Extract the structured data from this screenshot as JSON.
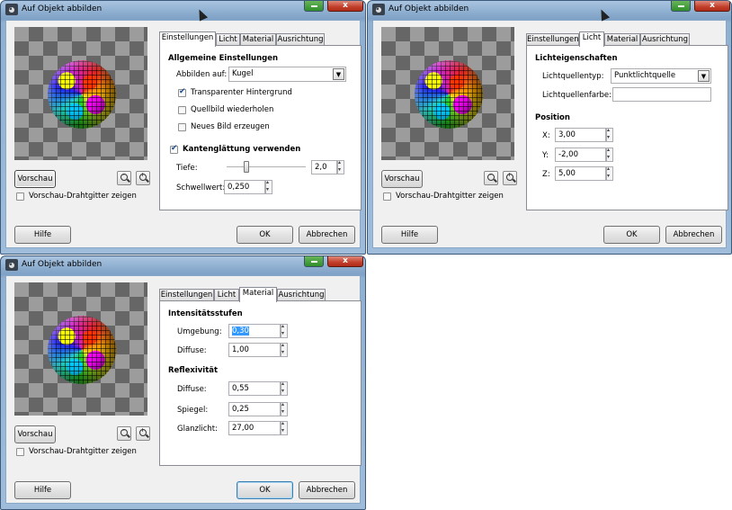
{
  "windows": [
    {
      "title": "Auf Objekt abbilden",
      "tabs": [
        "Einstellungen",
        "Licht",
        "Material",
        "Ausrichtung"
      ],
      "selected_tab": 0,
      "preview_button": "Vorschau",
      "wireframe_label": "Vorschau-Drahtgitter zeigen",
      "help_button": "Hilfe",
      "ok_button": "OK",
      "cancel_button": "Abbrechen",
      "close_glyph": "x",
      "panel": {
        "general_heading": "Allgemeine Einstellungen",
        "map_to_label": "Abbilden auf:",
        "map_to_value": "Kugel",
        "transparent_bg": "Transparenter Hintergrund",
        "tile_source": "Quellbild wiederholen",
        "new_image": "Neues Bild erzeugen",
        "antialias": "Kantenglättung verwenden",
        "depth_label": "Tiefe:",
        "depth_value": "2,0",
        "threshold_label": "Schwellwert:",
        "threshold_value": "0,250"
      }
    },
    {
      "title": "Auf Objekt abbilden",
      "tabs": [
        "Einstellungen",
        "Licht",
        "Material",
        "Ausrichtung"
      ],
      "selected_tab": 1,
      "preview_button": "Vorschau",
      "wireframe_label": "Vorschau-Drahtgitter zeigen",
      "help_button": "Hilfe",
      "ok_button": "OK",
      "cancel_button": "Abbrechen",
      "close_glyph": "x",
      "panel": {
        "light_heading": "Lichteigenschaften",
        "light_type_label": "Lichtquellentyp:",
        "light_type_value": "Punktlichtquelle",
        "light_color_label": "Lichtquellenfarbe:",
        "position_heading": "Position",
        "x_label": "X:",
        "x_value": "3,00",
        "y_label": "Y:",
        "y_value": "-2,00",
        "z_label": "Z:",
        "z_value": "5,00"
      }
    },
    {
      "title": "Auf Objekt abbilden",
      "tabs": [
        "Einstellungen",
        "Licht",
        "Material",
        "Ausrichtung"
      ],
      "selected_tab": 2,
      "preview_button": "Vorschau",
      "wireframe_label": "Vorschau-Drahtgitter zeigen",
      "help_button": "Hilfe",
      "ok_button": "OK",
      "cancel_button": "Abbrechen",
      "close_glyph": "x",
      "panel": {
        "intensity_heading": "Intensitätsstufen",
        "ambient_label": "Umgebung:",
        "ambient_value": "0,30",
        "diffuse_label": "Diffuse:",
        "diffuse_value": "1,00",
        "reflectivity_heading": "Reflexivität",
        "refl_diffuse_label": "Diffuse:",
        "refl_diffuse_value": "0,55",
        "specular_label": "Spiegel:",
        "specular_value": "0,25",
        "highlight_label": "Glanzlicht:",
        "highlight_value": "27,00"
      }
    }
  ]
}
